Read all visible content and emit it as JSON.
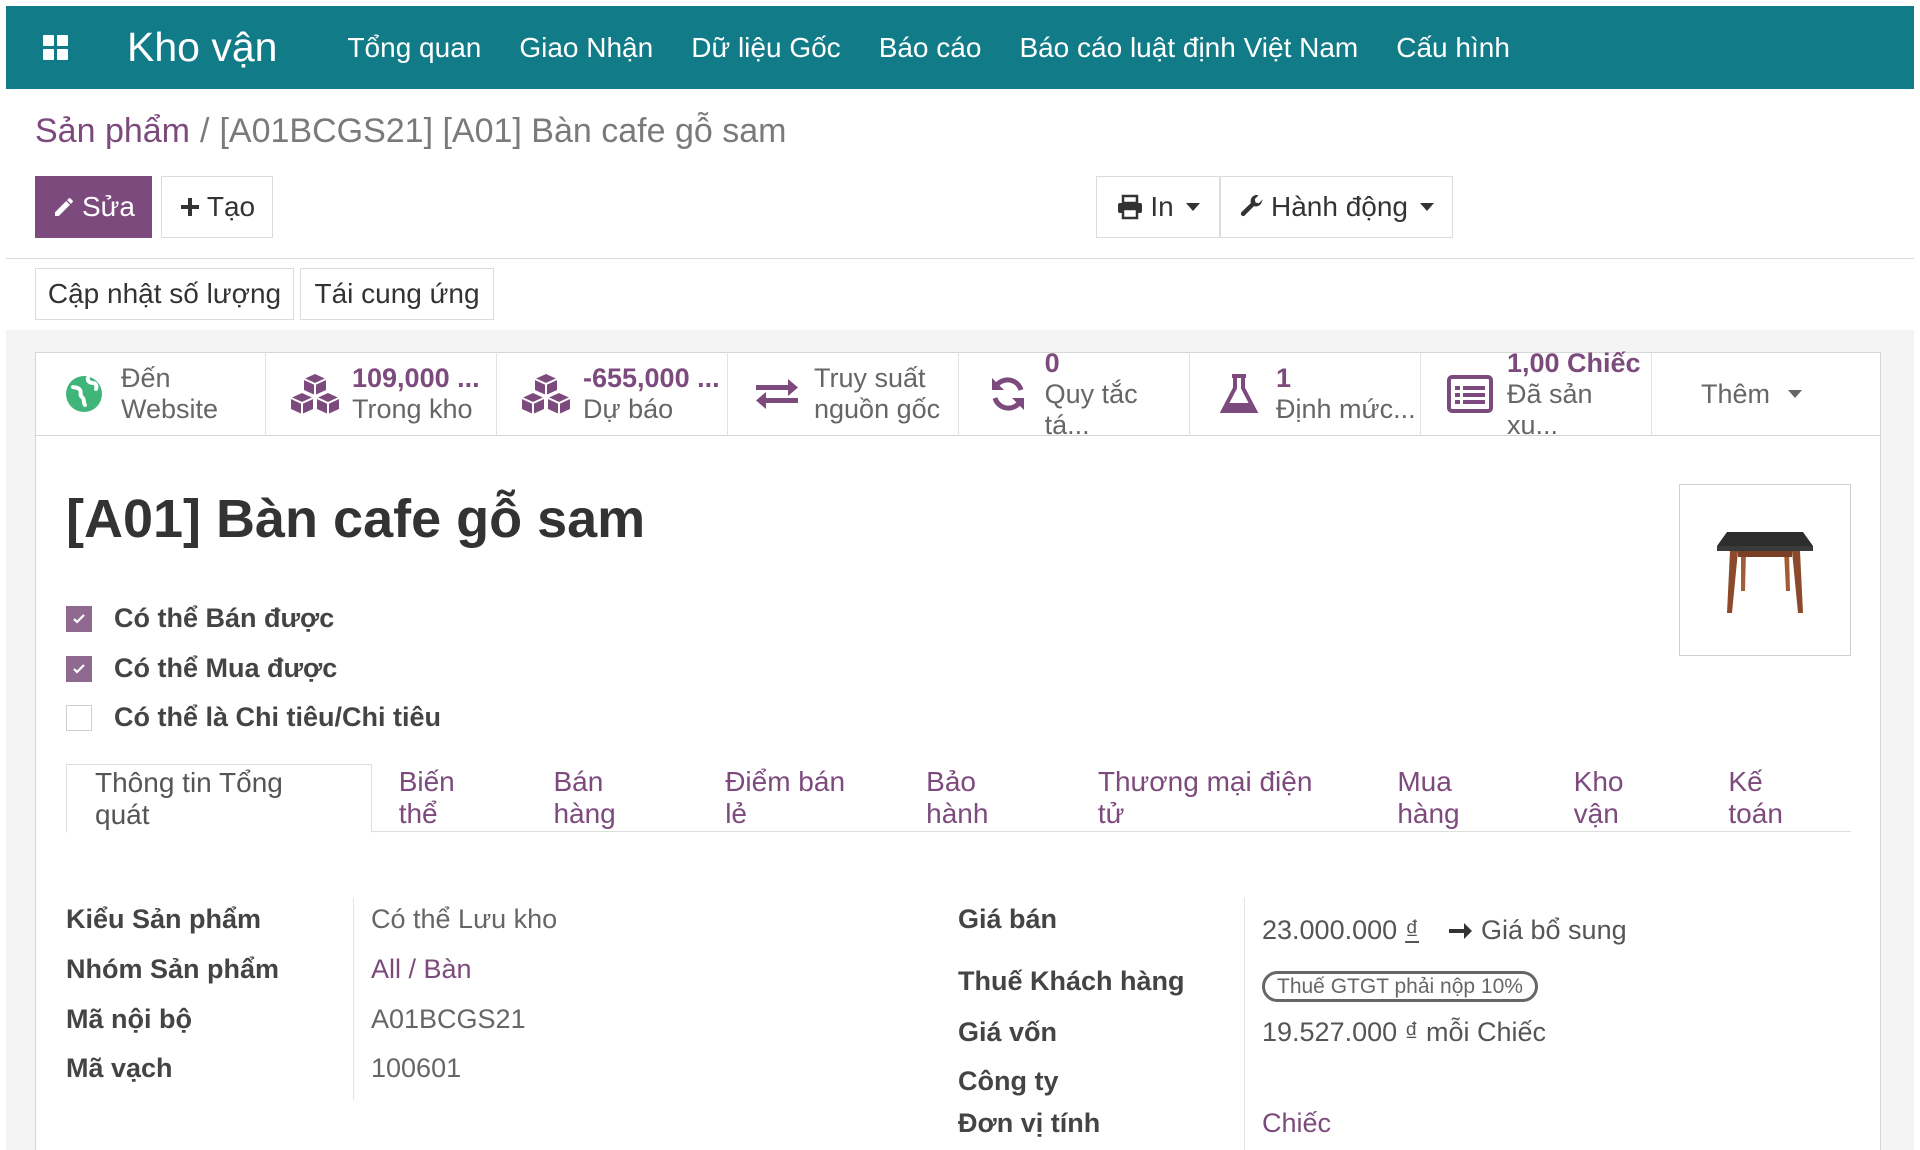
{
  "navbar": {
    "app_title": "Kho vận",
    "menu": [
      "Tổng quan",
      "Giao Nhận",
      "Dữ liệu Gốc",
      "Báo cáo",
      "Báo cáo luật định Việt Nam",
      "Cấu hình"
    ]
  },
  "breadcrumb": {
    "parent": "Sản phẩm",
    "separator": "/",
    "current": "[A01BCGS21] [A01] Bàn cafe gỗ sam"
  },
  "toolbar": {
    "edit_label": "Sửa",
    "create_label": "Tạo",
    "print_label": "In",
    "action_label": "Hành động"
  },
  "header_buttons": {
    "update_qty": "Cập nhật số lượng",
    "replenish": "Tái cung ứng"
  },
  "smart_buttons": [
    {
      "icon": "globe-icon",
      "value": "Đến",
      "label": "Website",
      "value_style": "plain"
    },
    {
      "icon": "cubes-icon",
      "value": "109,000 ...",
      "label": "Trong kho",
      "value_style": "accent"
    },
    {
      "icon": "cubes-icon",
      "value": "-655,000 ...",
      "label": "Dự báo",
      "value_style": "accent"
    },
    {
      "icon": "exchange-icon",
      "value": "Truy suất",
      "label": "nguồn gốc",
      "value_style": "plain"
    },
    {
      "icon": "refresh-icon",
      "value": "0",
      "label": "Quy tắc tá...",
      "value_style": "accent"
    },
    {
      "icon": "flask-icon",
      "value": "1",
      "label": "Định mức...",
      "value_style": "accent"
    },
    {
      "icon": "list-alt-icon",
      "value": "1,00 Chiếc",
      "label": "Đã sản xu...",
      "value_style": "accent"
    }
  ],
  "more_label": "Thêm",
  "product": {
    "name": "[A01] Bàn cafe gỗ sam",
    "image": "table-image"
  },
  "checkboxes": [
    {
      "label": "Có thể Bán được",
      "checked": true
    },
    {
      "label": "Có thể Mua được",
      "checked": true
    },
    {
      "label": "Có thể là Chi tiêu/Chi tiêu",
      "checked": false
    }
  ],
  "tabs": [
    "Thông tin Tổng quát",
    "Biến thể",
    "Bán hàng",
    "Điểm bán lẻ",
    "Bảo hành",
    "Thương mại điện tử",
    "Mua hàng",
    "Kho vận",
    "Kế toán"
  ],
  "active_tab": "Thông tin Tổng quát",
  "left_fields": [
    {
      "label": "Kiểu Sản phẩm",
      "value": "Có thể Lưu kho",
      "link": false
    },
    {
      "label": "Nhóm Sản phẩm",
      "value": "All / Bàn",
      "link": true
    },
    {
      "label": "Mã nội bộ",
      "value": "A01BCGS21",
      "link": false
    },
    {
      "label": "Mã vạch",
      "value": "100601",
      "link": false
    }
  ],
  "right_fields": {
    "sale_price_label": "Giá bán",
    "sale_price_value": "23.000.000",
    "currency": "₫",
    "extra_price": "Giá bổ sung",
    "customer_tax_label": "Thuế Khách hàng",
    "customer_tax_tag": "Thuế GTGT phải nộp 10%",
    "cost_label": "Giá vốn",
    "cost_value": "19.527.000 ₫ mỗi Chiếc",
    "company_label": "Công ty",
    "company_value": "",
    "uom_label": "Đơn vị tính",
    "uom_value": "Chiếc"
  },
  "colors": {
    "navbar": "#117c88",
    "accent": "#7c4a7d",
    "icon_green": "#3fb579",
    "icon_purple": "#7c4a7d"
  }
}
